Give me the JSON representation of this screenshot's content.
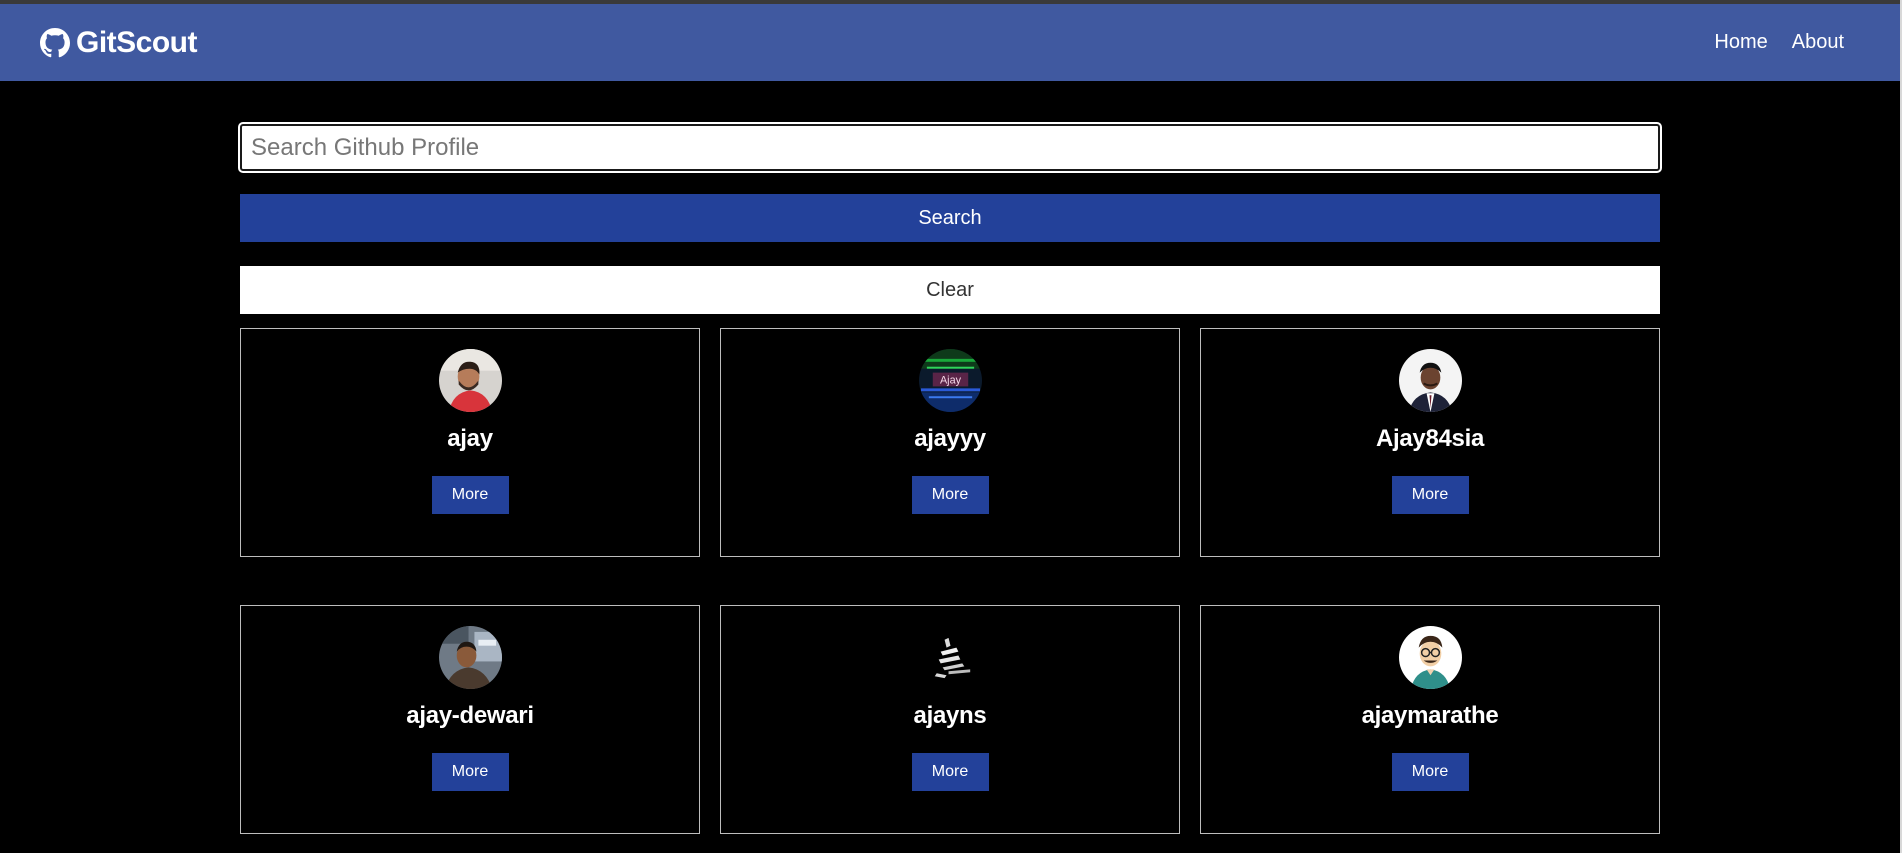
{
  "navbar": {
    "brand": "GitScout",
    "brand_icon": "github-icon",
    "links": [
      "Home",
      "About"
    ]
  },
  "search": {
    "placeholder": "Search Github Profile",
    "value": "",
    "search_label": "Search",
    "clear_label": "Clear"
  },
  "users": [
    {
      "login": "ajay",
      "avatar": "photo-man-red-shirt",
      "more_label": "More"
    },
    {
      "login": "ajayyy",
      "avatar": "neon-glitch-ajay",
      "more_label": "More"
    },
    {
      "login": "Ajay84sia",
      "avatar": "photo-man-suit",
      "more_label": "More"
    },
    {
      "login": "ajay-dewari",
      "avatar": "photo-man-car",
      "more_label": "More"
    },
    {
      "login": "ajayns",
      "avatar": "stylized-figure",
      "more_label": "More"
    },
    {
      "login": "ajaymarathe",
      "avatar": "cartoon-man-glasses",
      "more_label": "More"
    }
  ],
  "colors": {
    "navbar": "#4059a0",
    "primary": "#23419a",
    "background": "#000000"
  }
}
